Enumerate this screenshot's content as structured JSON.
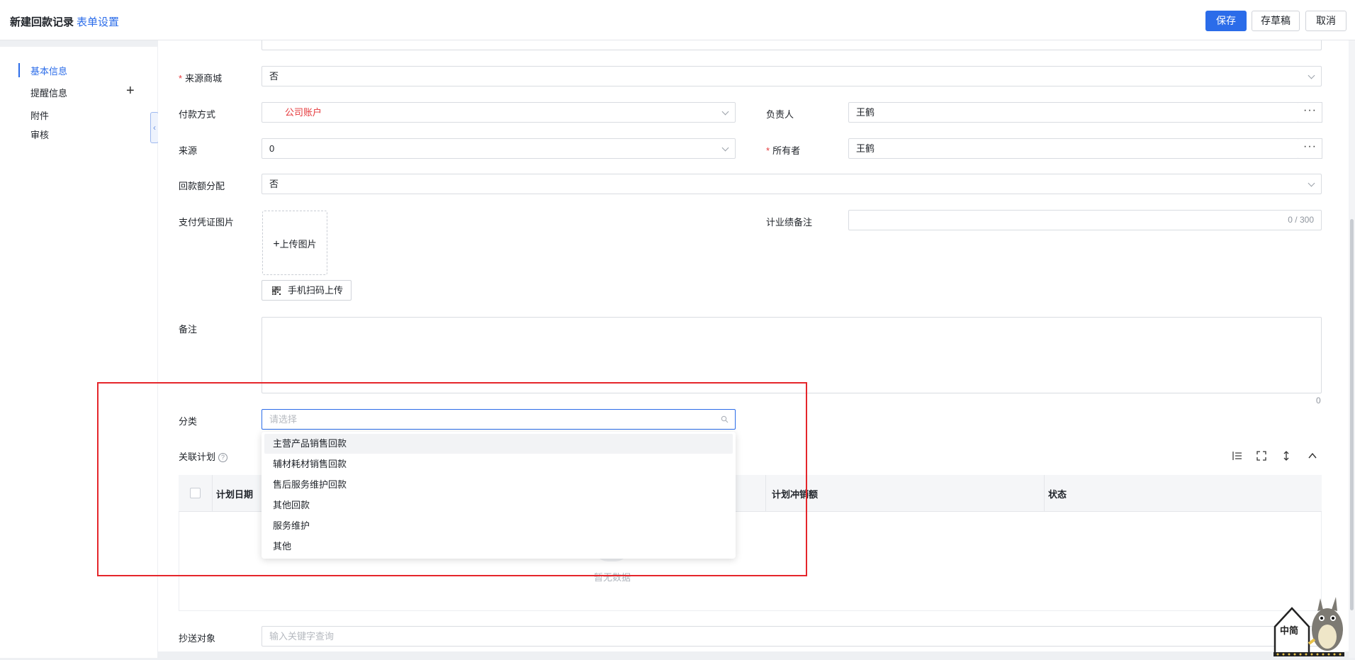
{
  "header": {
    "title": "新建回款记录",
    "form_setting": "表单设置",
    "save": "保存",
    "draft": "存草稿",
    "cancel": "取消"
  },
  "sidebar": {
    "items": [
      "基本信息",
      "提醒信息",
      "附件",
      "审核"
    ],
    "active": "基本信息"
  },
  "form": {
    "source_mall_label": "来源商城",
    "source_mall_value": "否",
    "payment_method_label": "付款方式",
    "payment_method_value": "公司账户",
    "owner_label": "负责人",
    "owner_value": "王鹤",
    "source_label": "来源",
    "source_value": "0",
    "holder_label": "所有者",
    "holder_value": "王鹤",
    "allocation_label": "回款额分配",
    "allocation_value": "否",
    "voucher_label": "支付凭证图片",
    "upload_label": "上传图片",
    "scan_label": "手机扫码上传",
    "perf_remark_label": "计业绩备注",
    "perf_remark_count": "0 / 300",
    "remark_label": "备注",
    "remark_count": "0",
    "category_label": "分类",
    "category_placeholder": "请选择",
    "related_plan_label": "关联计划",
    "cc_label": "抄送对象",
    "cc_placeholder": "输入关键字查询"
  },
  "dropdown": {
    "options": [
      "主营产品销售回款",
      "辅材耗材销售回款",
      "售后服务维护回款",
      "其他回款",
      "服务维护",
      "其他"
    ]
  },
  "table": {
    "columns": [
      "计划日期",
      "计划冲销额",
      "状态"
    ],
    "empty_text": "暂无数据"
  },
  "mascot": {
    "text": "中简"
  },
  "colors": {
    "primary": "#2b6ce9",
    "required": "#e5383b",
    "payment_value": "#e5383b",
    "highlight_box": "#e5262b"
  }
}
